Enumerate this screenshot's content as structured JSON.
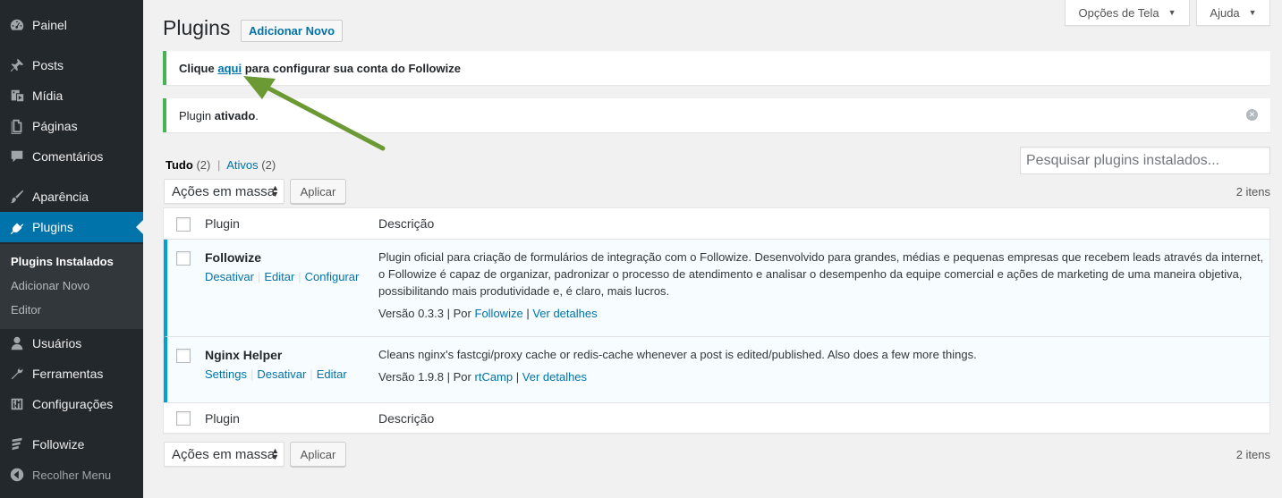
{
  "sidebar": {
    "items": [
      {
        "label": "Painel",
        "icon": "dashboard-icon"
      },
      {
        "label": "Posts",
        "icon": "pin-icon"
      },
      {
        "label": "Mídia",
        "icon": "media-icon"
      },
      {
        "label": "Páginas",
        "icon": "page-icon"
      },
      {
        "label": "Comentários",
        "icon": "comment-icon"
      },
      {
        "label": "Aparência",
        "icon": "brush-icon"
      },
      {
        "label": "Plugins",
        "icon": "plugin-icon"
      },
      {
        "label": "Usuários",
        "icon": "user-icon"
      },
      {
        "label": "Ferramentas",
        "icon": "wrench-icon"
      },
      {
        "label": "Configurações",
        "icon": "settings-icon"
      },
      {
        "label": "Followize",
        "icon": "followize-icon"
      },
      {
        "label": "Recolher Menu",
        "icon": "collapse-icon"
      }
    ],
    "submenu": [
      "Plugins Instalados",
      "Adicionar Novo",
      "Editor"
    ],
    "active_color": "#0073aa"
  },
  "screen_meta": {
    "options_label": "Opções de Tela",
    "help_label": "Ajuda"
  },
  "header": {
    "title": "Plugins",
    "add_new": "Adicionar Novo"
  },
  "notices": {
    "followize": {
      "before": "Clique ",
      "link": "aqui",
      "after": " para configurar sua conta do Followize"
    },
    "activated": {
      "before": "Plugin ",
      "bold": "ativado",
      "after": "."
    }
  },
  "filters": {
    "all": "Tudo",
    "all_count": "(2)",
    "separator": "|",
    "active": "Ativos",
    "active_count": "(2)"
  },
  "search": {
    "placeholder": "Pesquisar plugins instalados..."
  },
  "bulk": {
    "select_label": "Ações em massa",
    "apply_label": "Aplicar",
    "items_count": "2 itens"
  },
  "table": {
    "col_plugin": "Plugin",
    "col_description": "Descrição",
    "rows": [
      {
        "name": "Followize",
        "actions": [
          "Desativar",
          "Editar",
          "Configurar"
        ],
        "description": "Plugin oficial para criação de formulários de integração com o Followize. Desenvolvido para grandes, médias e pequenas empresas que recebem leads através da internet, o Followize é capaz de organizar, padronizar o processo de atendimento e analisar o desempenho da equipe comercial e ações de marketing de uma maneira objetiva, possibilitando mais produtividade e, é claro, mais lucros.",
        "version": "Versão 0.3.3",
        "by": "Por",
        "author": "Followize",
        "details": "Ver detalhes"
      },
      {
        "name": "Nginx Helper",
        "actions": [
          "Settings",
          "Desativar",
          "Editar"
        ],
        "description": "Cleans nginx's fastcgi/proxy cache or redis-cache whenever a post is edited/published. Also does a few more things.",
        "version": "Versão 1.9.8",
        "by": "Por",
        "author": "rtCamp",
        "details": "Ver detalhes"
      }
    ]
  },
  "colors": {
    "link": "#0073aa",
    "notice_green": "#46b450",
    "active_plugin_border": "#00a0d2",
    "annotation_arrow": "#6b9a35"
  }
}
